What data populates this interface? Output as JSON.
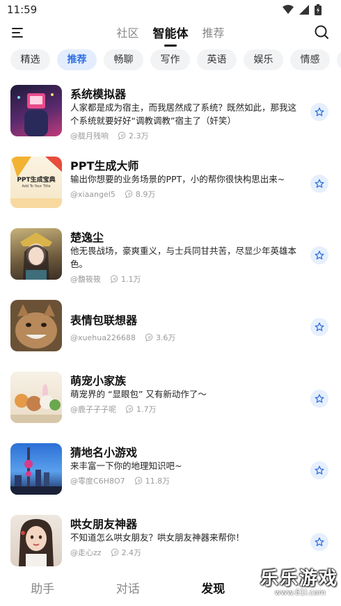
{
  "status": {
    "time": "11:59"
  },
  "header": {
    "tabs": [
      {
        "label": "社区"
      },
      {
        "label": "智能体"
      },
      {
        "label": "推荐"
      }
    ]
  },
  "categories": [
    "精选",
    "推荐",
    "畅聊",
    "写作",
    "英语",
    "娱乐",
    "情感"
  ],
  "items": [
    {
      "title": "系统模拟器",
      "desc": "人家都是成为宿主，而我居然成了系统？既然如此，那我这个系统就要好好“调教调教”宿主了（奸笑）",
      "author": "@胧月残响",
      "count": "2.3万"
    },
    {
      "title": "PPT生成大师",
      "desc": "输出你想要的业务场景的PPT，小的帮你很快构思出来~",
      "author": "@xiaangel5",
      "count": "8.9万"
    },
    {
      "title": "楚逸尘",
      "desc": "他无畏战场，豪爽重义，与士兵同甘共苦，尽显少年英雄本色。",
      "author": "@馥筱筱",
      "count": "1.1万"
    },
    {
      "title": "表情包联想器",
      "desc": "",
      "author": "@xuehua226688",
      "count": "3.6万"
    },
    {
      "title": "萌宠小家族",
      "desc": "萌宠界的 “显眼包” 又有新动作了～",
      "author": "@鹿子子子呢",
      "count": "1.7万"
    },
    {
      "title": "猜地名小游戏",
      "desc": "来丰富一下你的地理知识吧~",
      "author": "@零度C6H8O7",
      "count": "11.8万"
    },
    {
      "title": "哄女朋友神器",
      "desc": "不知道怎么哄女朋友？哄女朋友神器来帮你！",
      "author": "@走心zz",
      "count": "2.4万"
    }
  ],
  "thumbs": {
    "ppt_text": "PPT生成宝典",
    "ppt_sub": "Add To Your Title"
  },
  "bottom_nav": [
    {
      "label": "助手"
    },
    {
      "label": "对话"
    },
    {
      "label": "发现"
    }
  ],
  "watermark": {
    "text": "乐乐游戏",
    "url": "www.61l.com"
  },
  "colors": {
    "accent": "#2f6fe0",
    "chip_bg": "#f2f3f5",
    "star_bg": "#e6effd"
  }
}
